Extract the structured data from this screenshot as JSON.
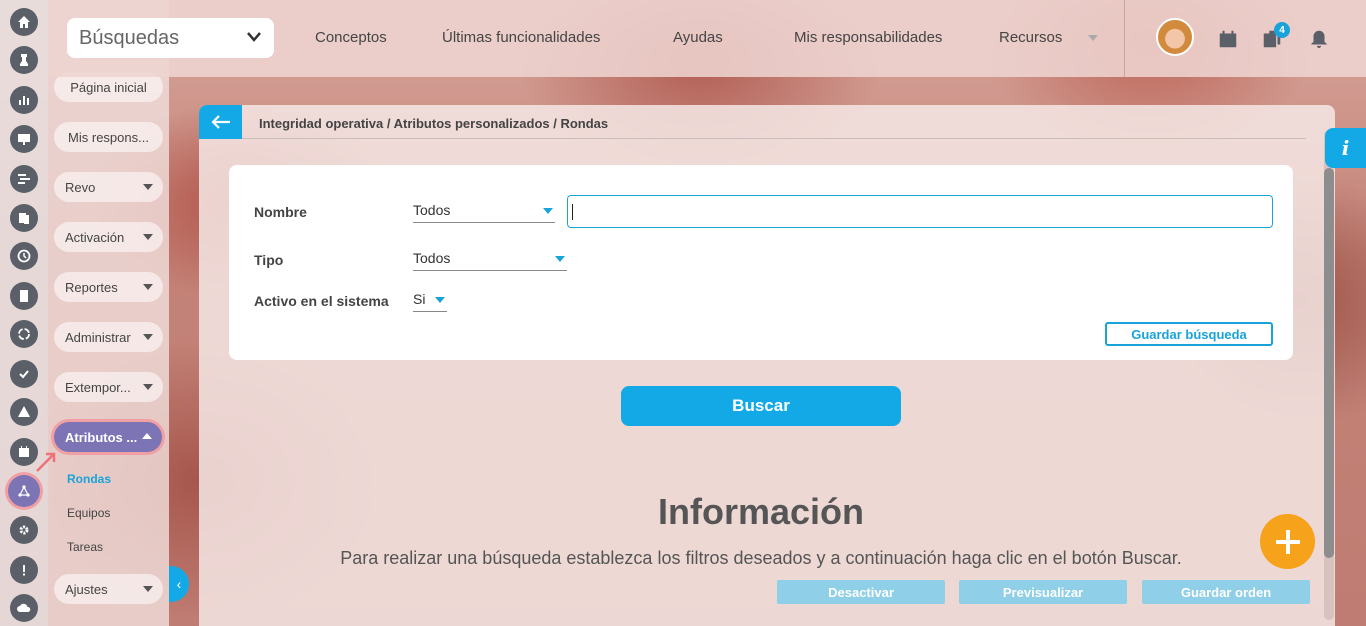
{
  "topbar": {
    "search_select": "Búsquedas",
    "nav": [
      "Conceptos",
      "Últimas funcionalidades",
      "Ayudas",
      "Mis responsabilidades",
      "Recursos"
    ],
    "notification_count": "4"
  },
  "menu": {
    "items": [
      "Página inicial",
      "Mis respons...",
      "Revo",
      "Activación",
      "Reportes",
      "Administrar",
      "Extempor...",
      "Atributos ...",
      "Ajustes"
    ],
    "subitems": [
      "Rondas",
      "Equipos",
      "Tareas"
    ],
    "selected_subitem": "Rondas"
  },
  "panel": {
    "breadcrumb": "Integridad operativa / Atributos personalizados / Rondas"
  },
  "filters": {
    "nombre_label": "Nombre",
    "nombre_value": "Todos",
    "nombre_text": "",
    "tipo_label": "Tipo",
    "tipo_value": "Todos",
    "activo_label": "Activo en el sistema",
    "activo_value": "Si",
    "save_search": "Guardar búsqueda"
  },
  "search_button": "Buscar",
  "info": {
    "title": "Información",
    "text": "Para realizar una búsqueda establezca los filtros deseados y a continuación haga clic en el botón Buscar."
  },
  "footer_buttons": [
    "Desactivar",
    "Previsualizar",
    "Guardar orden"
  ],
  "info_tab": "i",
  "colors": {
    "accent": "#12a9e6",
    "active_menu": "#7d74b6",
    "highlight": "#f0a0a5",
    "fab": "#f7a21b"
  }
}
